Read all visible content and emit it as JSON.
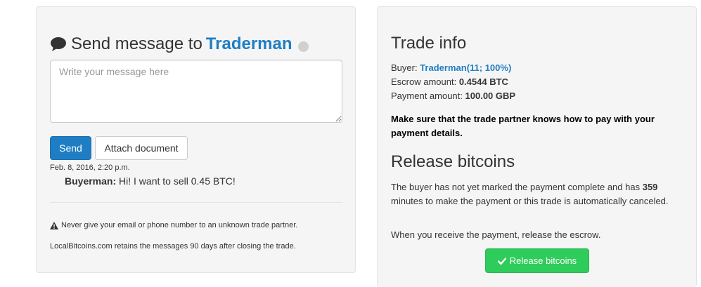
{
  "chat": {
    "title_prefix": "Send message to",
    "partner_name": "Traderman",
    "textarea_placeholder": "Write your message here",
    "send_label": "Send",
    "attach_label": "Attach document",
    "messages": [
      {
        "date": "Feb. 8, 2016, 2:20 p.m.",
        "author": "Buyerman:",
        "text": "Hi! I want to sell 0.45 BTC!"
      }
    ],
    "warning": "Never give your email or phone number to an unknown trade partner.",
    "retention": "LocalBitcoins.com retains the messages 90 days after closing the trade."
  },
  "trade": {
    "heading": "Trade info",
    "buyer_label": "Buyer:",
    "buyer_name": "Traderman",
    "buyer_stats": "(11; 100%)",
    "escrow_label": "Escrow amount:",
    "escrow_value": "0.4544 BTC",
    "payment_label": "Payment amount:",
    "payment_value": "100.00 GBP",
    "notice": "Make sure that the trade partner knows how to pay with your payment details."
  },
  "release": {
    "heading": "Release bitcoins",
    "text_before": "The buyer has not yet marked the payment complete and has",
    "minutes": "359",
    "text_after": "minutes to make the payment or this trade is automatically canceled.",
    "instruction": "When you receive the payment, release the escrow.",
    "button_label": "Release bitcoins"
  },
  "colors": {
    "link": "#1f7ec3",
    "primary_button": "#1f7ec3",
    "success_button": "#2ecc5a",
    "panel_background": "#f5f5f5"
  },
  "icons": {
    "title": "comment-icon",
    "presence": "presence-dot-icon",
    "warning": "warning-icon",
    "release": "check-icon"
  }
}
